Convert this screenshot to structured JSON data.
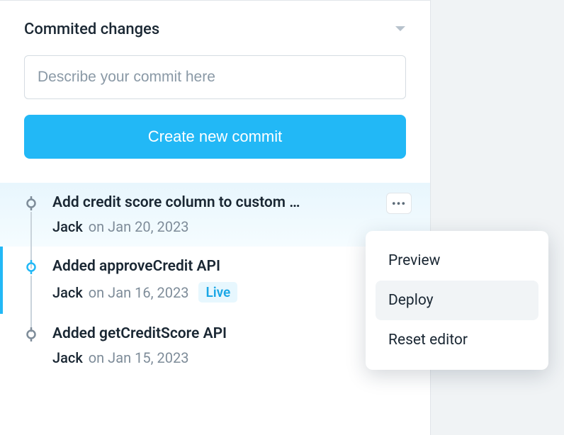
{
  "header": {
    "title": "Commited changes"
  },
  "input": {
    "placeholder": "Describe your commit here",
    "value": ""
  },
  "create_button_label": "Create new commit",
  "commits": [
    {
      "title": "Add credit score column to custom …",
      "author": "Jack",
      "date": "on Jan 20, 2023",
      "selected": true,
      "live": false,
      "has_menu": true
    },
    {
      "title": "Added approveCredit API",
      "author": "Jack",
      "date": "on Jan 16, 2023",
      "selected": false,
      "live": true,
      "has_menu": false,
      "active_indicator": true
    },
    {
      "title": "Added getCreditScore API",
      "author": "Jack",
      "date": "on Jan 15, 2023",
      "selected": false,
      "live": false,
      "has_menu": false
    }
  ],
  "live_label": "Live",
  "more_icon": "•••",
  "dropdown": {
    "items": [
      {
        "label": "Preview",
        "highlight": false
      },
      {
        "label": "Deploy",
        "highlight": true
      },
      {
        "label": "Reset editor",
        "highlight": false
      }
    ]
  },
  "colors": {
    "accent": "#22b8f6",
    "marker_gray": "#7e8c99"
  }
}
